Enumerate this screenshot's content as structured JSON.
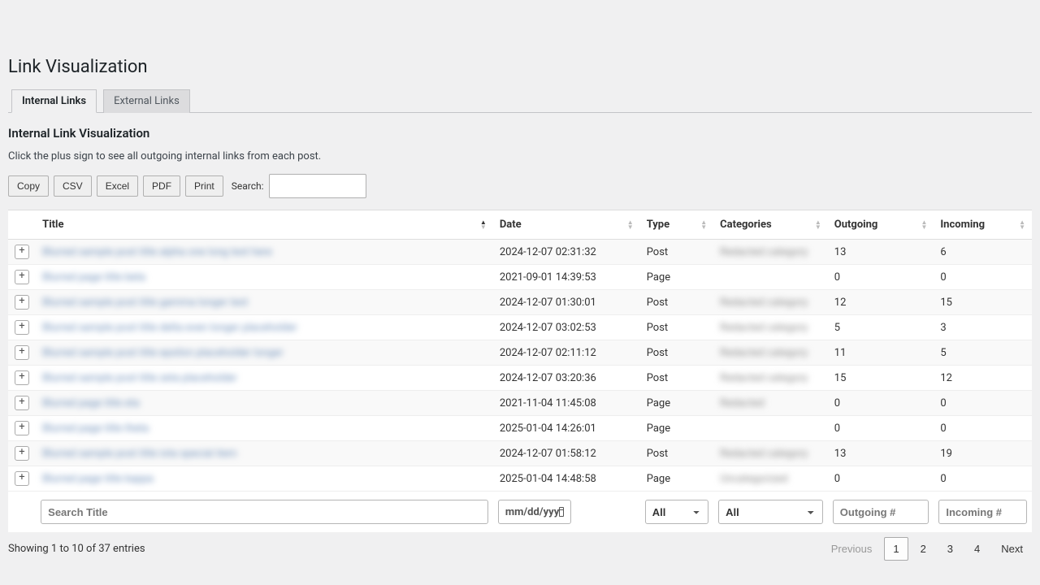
{
  "page_title": "Link Visualization",
  "tabs": [
    {
      "label": "Internal Links",
      "active": true
    },
    {
      "label": "External Links",
      "active": false
    }
  ],
  "section_title": "Internal Link Visualization",
  "description": "Click the plus sign to see all outgoing internal links from each post.",
  "toolbar": {
    "buttons": [
      "Copy",
      "CSV",
      "Excel",
      "PDF",
      "Print"
    ],
    "search_label": "Search:",
    "search_value": ""
  },
  "columns": [
    {
      "key": "expand",
      "label": "",
      "sortable": false
    },
    {
      "key": "title",
      "label": "Title",
      "sortable": true,
      "sorted": "asc"
    },
    {
      "key": "date",
      "label": "Date",
      "sortable": true
    },
    {
      "key": "type",
      "label": "Type",
      "sortable": true
    },
    {
      "key": "categories",
      "label": "Categories",
      "sortable": true
    },
    {
      "key": "outgoing",
      "label": "Outgoing",
      "sortable": true
    },
    {
      "key": "incoming",
      "label": "Incoming",
      "sortable": true
    }
  ],
  "rows": [
    {
      "title": "Blurred sample post title alpha one long text here",
      "date": "2024-12-07 02:31:32",
      "type": "Post",
      "categories": "Redacted category",
      "outgoing": "13",
      "incoming": "6"
    },
    {
      "title": "Blurred page title beta",
      "date": "2021-09-01 14:39:53",
      "type": "Page",
      "categories": "",
      "outgoing": "0",
      "incoming": "0"
    },
    {
      "title": "Blurred sample post title gamma longer text",
      "date": "2024-12-07 01:30:01",
      "type": "Post",
      "categories": "Redacted category",
      "outgoing": "12",
      "incoming": "15"
    },
    {
      "title": "Blurred sample post title delta even longer placeholder",
      "date": "2024-12-07 03:02:53",
      "type": "Post",
      "categories": "Redacted category",
      "outgoing": "5",
      "incoming": "3"
    },
    {
      "title": "Blurred sample post title epsilon placeholder longer",
      "date": "2024-12-07 02:11:12",
      "type": "Post",
      "categories": "Redacted category",
      "outgoing": "11",
      "incoming": "5"
    },
    {
      "title": "Blurred sample post title zeta placeholder",
      "date": "2024-12-07 03:20:36",
      "type": "Post",
      "categories": "Redacted category",
      "outgoing": "15",
      "incoming": "12"
    },
    {
      "title": "Blurred page title eta",
      "date": "2021-11-04 11:45:08",
      "type": "Page",
      "categories": "Redacted",
      "outgoing": "0",
      "incoming": "0"
    },
    {
      "title": "Blurred page title theta",
      "date": "2025-01-04 14:26:01",
      "type": "Page",
      "categories": "",
      "outgoing": "0",
      "incoming": "0"
    },
    {
      "title": "Blurred sample post title iota special item",
      "date": "2024-12-07 01:58:12",
      "type": "Post",
      "categories": "Redacted category",
      "outgoing": "13",
      "incoming": "19"
    },
    {
      "title": "Blurred page title kappa",
      "date": "2025-01-04 14:48:58",
      "type": "Page",
      "categories": "Uncategorized",
      "outgoing": "0",
      "incoming": "0"
    }
  ],
  "filters": {
    "title_placeholder": "Search Title",
    "date_placeholder": "mm/dd/yyy",
    "type_options": [
      "All"
    ],
    "cat_options": [
      "All"
    ],
    "outgoing_placeholder": "Outgoing #",
    "incoming_placeholder": "Incoming #"
  },
  "entries_info": "Showing 1 to 10 of 37 entries",
  "pagination": {
    "previous": "Previous",
    "next": "Next",
    "pages": [
      "1",
      "2",
      "3",
      "4"
    ],
    "active": "1"
  },
  "expand_glyph": "+"
}
